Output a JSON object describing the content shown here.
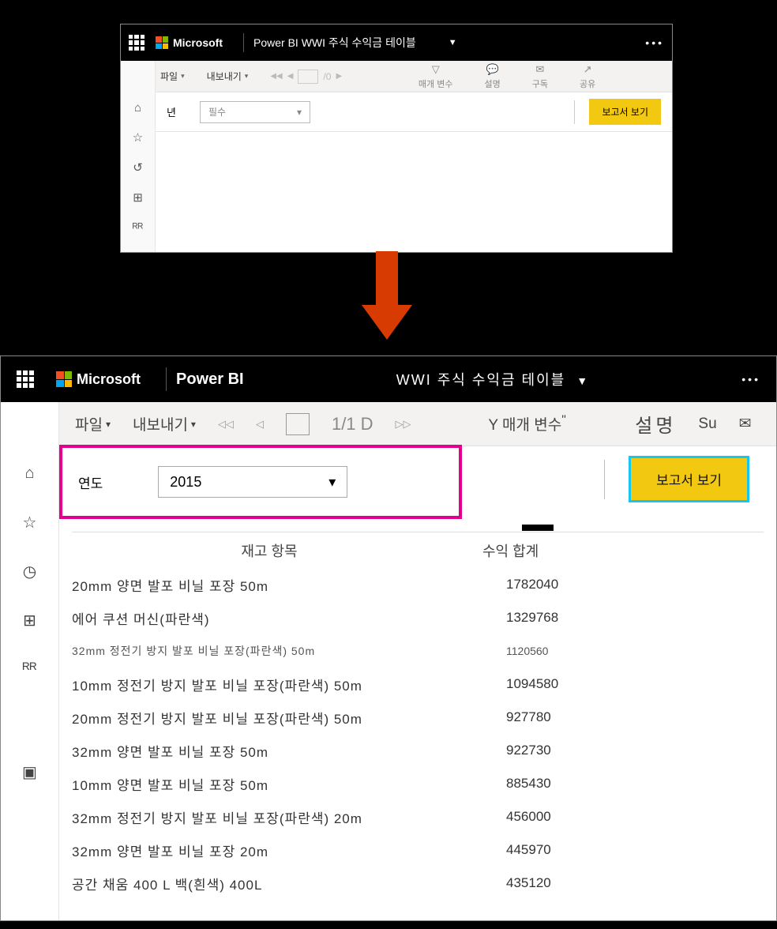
{
  "top": {
    "ms": "Microsoft",
    "title": "Power BI WWI 주식 수익금 테이블",
    "toolbar": {
      "file": "파일",
      "export": "내보내기",
      "page": "/0",
      "filter": "매개 변수",
      "comments": "설명",
      "subscribe": "구독",
      "share": "공유"
    },
    "param": {
      "label": "년",
      "placeholder": "필수",
      "button": "보고서 보기"
    }
  },
  "bottom": {
    "ms": "Microsoft",
    "pbi": "Power BI",
    "title": "WWI 주식 수익금 테이블",
    "toolbar": {
      "file": "파일",
      "export": "내보내기",
      "page": "1/1 D",
      "filter_pre": "Y",
      "filter": "매개 변수",
      "comments": "설명",
      "sub": "Su"
    },
    "param": {
      "label": "연도",
      "value": "2015",
      "button": "보고서 보기"
    },
    "table": {
      "col1": "재고 항목",
      "col2": "수익 합계",
      "rows": [
        {
          "item": "20mm 양면 발포 비닐 포장 50m",
          "val": "1782040"
        },
        {
          "item": "에어 쿠션 머신(파란색)",
          "val": "1329768"
        },
        {
          "item": "32mm 정전기 방지 발포 비닐 포장(파란색) 50m",
          "val": "1120560",
          "sm": true
        },
        {
          "item": "10mm 정전기 방지 발포 비닐 포장(파란색) 50m",
          "val": "1094580"
        },
        {
          "item": "20mm 정전기 방지 발포 비닐 포장(파란색) 50m",
          "val": "927780"
        },
        {
          "item": "32mm 양면 발포 비닐 포장 50m",
          "val": "922730"
        },
        {
          "item": "10mm 양면 발포 비닐 포장 50m",
          "val": "885430"
        },
        {
          "item": "32mm 정전기 방지 발포 비닐 포장(파란색) 20m",
          "val": "456000"
        },
        {
          "item": "32mm 양면 발포 비닐 포장 20m",
          "val": "445970"
        },
        {
          "item": "공간 채움 400 L 백(흰색) 400L",
          "val": "435120"
        }
      ]
    }
  }
}
